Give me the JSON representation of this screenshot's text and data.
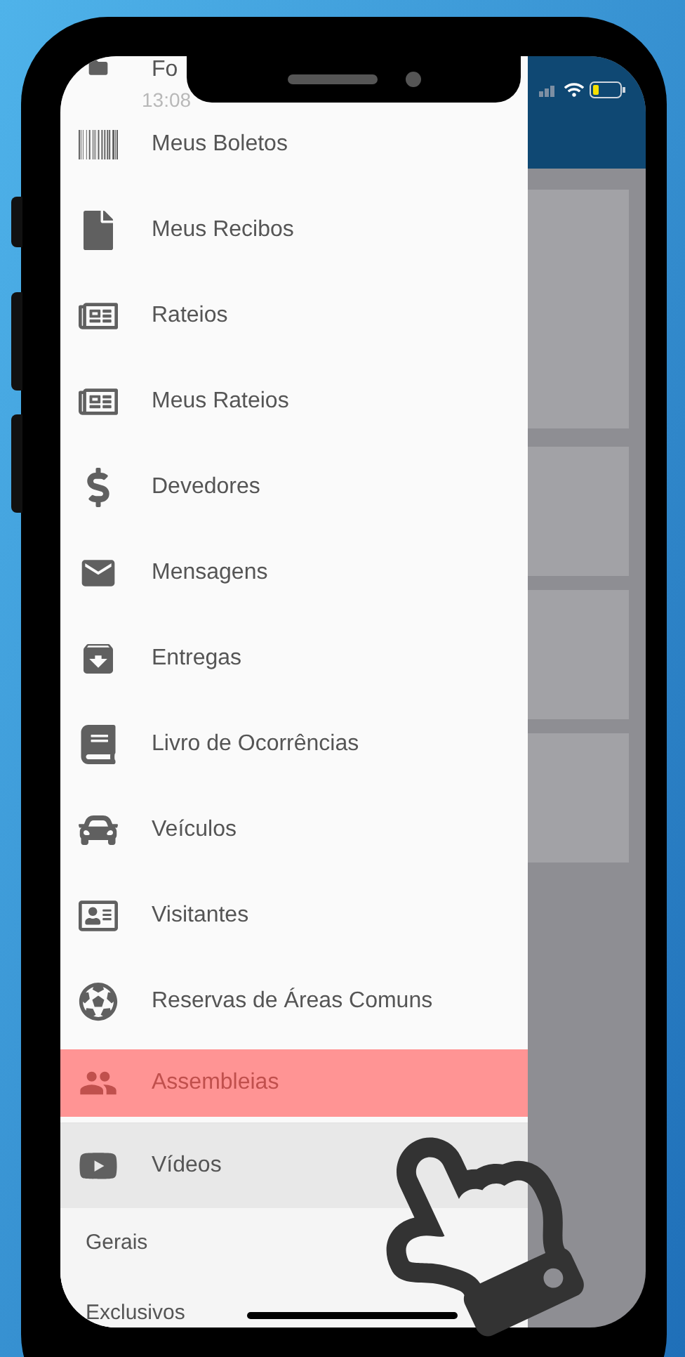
{
  "status_bar": {
    "time": "13:08"
  },
  "drawer": {
    "items": [
      {
        "label": "Fo",
        "selected": false
      },
      {
        "label": "Meus Boletos",
        "selected": false
      },
      {
        "label": "Meus Recibos",
        "selected": false
      },
      {
        "label": "Rateios",
        "selected": false
      },
      {
        "label": "Meus Rateios",
        "selected": false
      },
      {
        "label": "Devedores",
        "selected": false
      },
      {
        "label": "Mensagens",
        "selected": false
      },
      {
        "label": "Entregas",
        "selected": false
      },
      {
        "label": "Livro de Ocorrências",
        "selected": false
      },
      {
        "label": "Veículos",
        "selected": false
      },
      {
        "label": "Visitantes",
        "selected": false
      },
      {
        "label": "Reservas de Áreas Comuns",
        "selected": false
      },
      {
        "label": "Assembleias",
        "selected": true
      },
      {
        "label": "Vídeos",
        "selected": false,
        "expanded": true,
        "children": [
          {
            "label": "Gerais"
          },
          {
            "label": "Exclusivos"
          }
        ]
      }
    ]
  }
}
